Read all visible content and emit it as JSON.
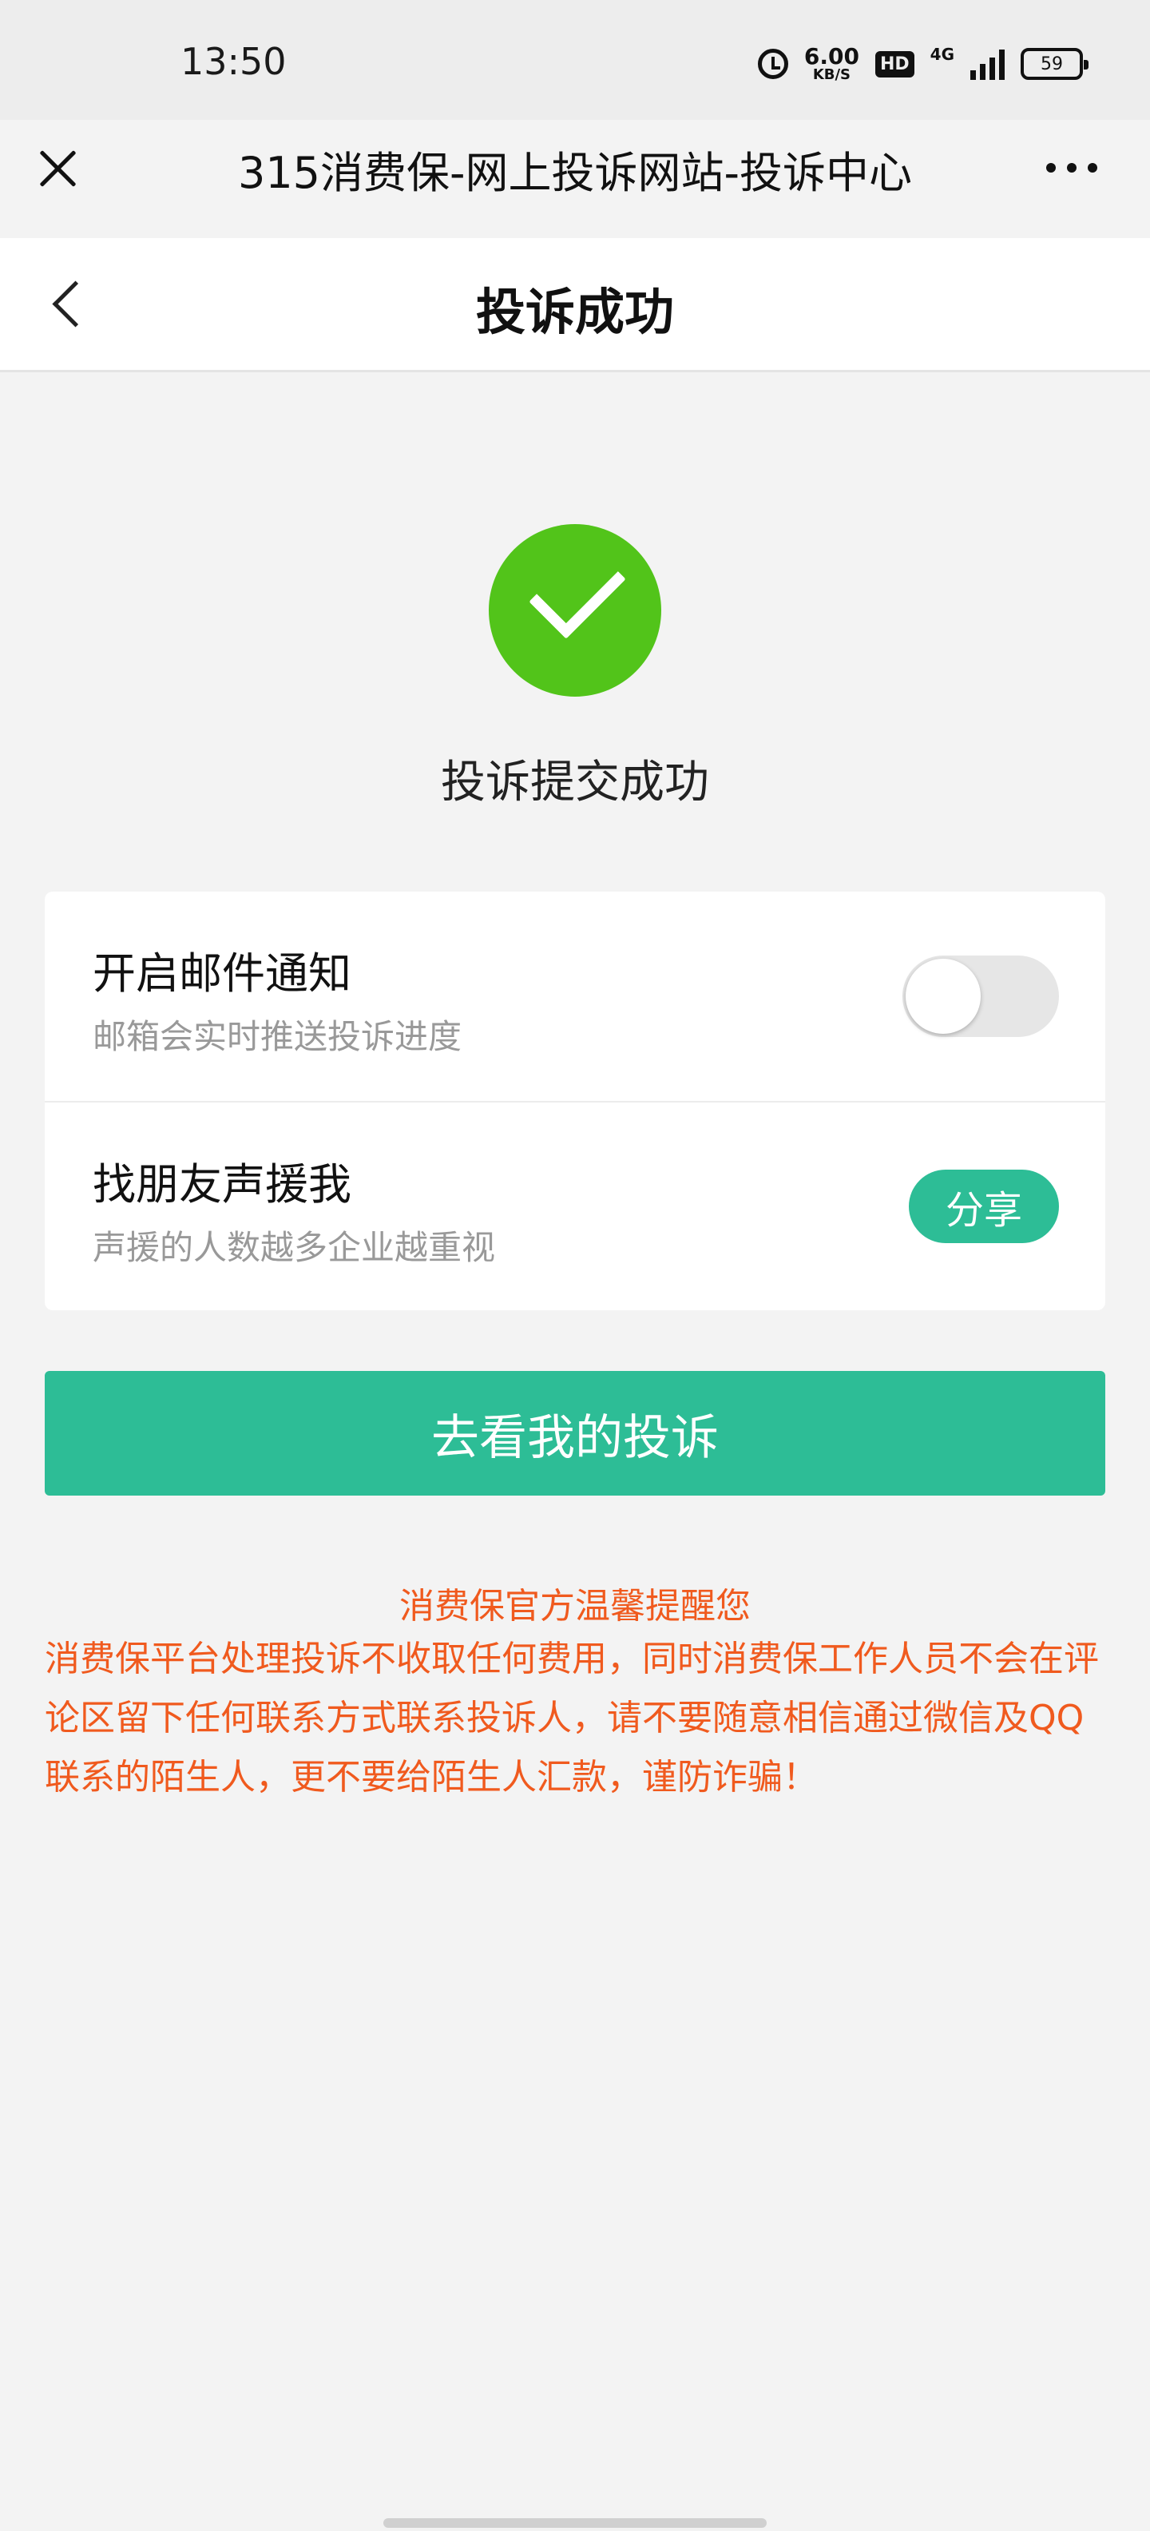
{
  "status_bar": {
    "time": "13:50",
    "net_speed_value": "6.00",
    "net_speed_unit": "KB/S",
    "hd_label": "HD",
    "network_type": "4G",
    "battery": "59"
  },
  "browser_header": {
    "title": "315消费保-网上投诉网站-投诉中心"
  },
  "nav": {
    "title": "投诉成功"
  },
  "success": {
    "message": "投诉提交成功"
  },
  "options": {
    "email_notify": {
      "title": "开启邮件通知",
      "subtitle": "邮箱会实时推送投诉进度",
      "enabled": false
    },
    "friend_support": {
      "title": "找朋友声援我",
      "subtitle": "声援的人数越多企业越重视",
      "button_label": "分享"
    }
  },
  "primary_button": {
    "label": "去看我的投诉"
  },
  "notice": {
    "title": "消费保官方温馨提醒您",
    "body": "消费保平台处理投诉不收取任何费用，同时消费保工作人员不会在评论区留下任何联系方式联系投诉人，请不要随意相信通过微信及QQ 联系的陌生人，更不要给陌生人汇款，谨防诈骗！"
  },
  "colors": {
    "accent": "#2dbd96",
    "success": "#52c41a",
    "warning_text": "#f05a1e"
  }
}
